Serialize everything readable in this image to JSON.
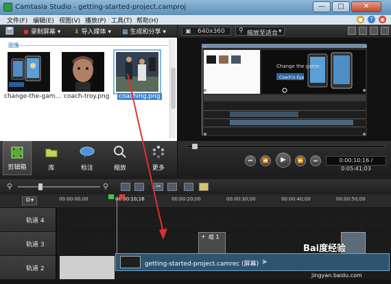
{
  "window": {
    "title": "Camtasia Studio - getting-started-project.camproj",
    "min": "—",
    "max": "□",
    "close": "✕"
  },
  "menu": [
    "文件(F)",
    "编辑(E)",
    "视图(V)",
    "播放(P)",
    "工具(T)",
    "帮助(H)"
  ],
  "toolbar": {
    "record": "录制屏幕",
    "import": "导入媒体",
    "produce": "生成和分享"
  },
  "bin": {
    "section": "图像",
    "items": [
      {
        "label": "change-the-gam..."
      },
      {
        "label": "coach-troy.png"
      },
      {
        "label": "coaching.png"
      }
    ]
  },
  "tabs": [
    "剪辑箱",
    "库",
    "标注",
    "缩放",
    "更多"
  ],
  "preview": {
    "size": "640x360",
    "zoom": "缩放至适合",
    "timecode": "0:00:10;16 / 0:05:41;03"
  },
  "preview_content": {
    "headline": "Change the game.",
    "brand": "Coach's Eye"
  },
  "timeline": {
    "ticks": [
      "00:00:00;00",
      "00:00:10;16",
      "00:00:20;00",
      "00:00:30;00",
      "00:00:40;00",
      "00:00:50;00"
    ],
    "tracks": [
      "轨道 4",
      "轨道 3",
      "轨道 2"
    ],
    "group": "组 1",
    "clip": "getting-started-project.camrec (屏幕)"
  },
  "watermark": {
    "logo": "Bai度经验",
    "url": "jingyan.baidu.com"
  },
  "colors": {
    "accent": "#3d83d6",
    "playhead": "#e03030",
    "dark_bg": "#1e1e1e"
  }
}
